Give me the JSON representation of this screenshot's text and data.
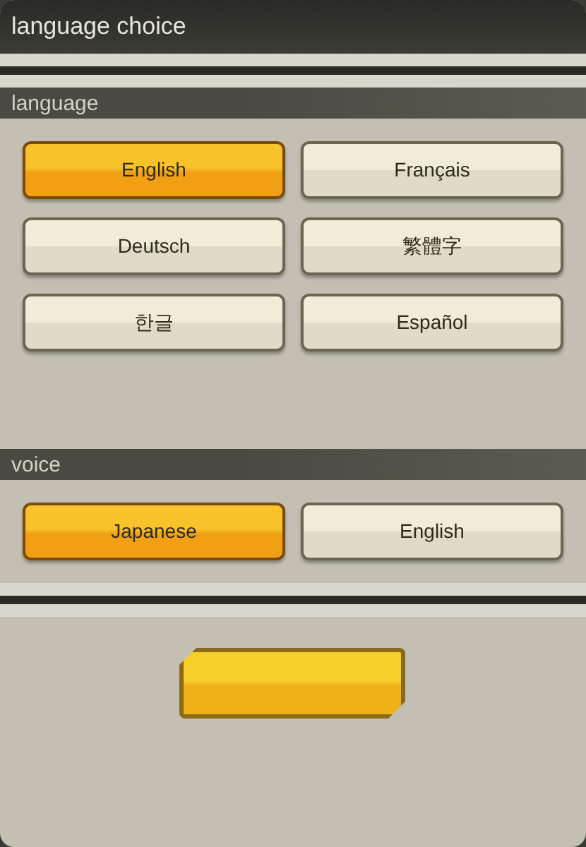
{
  "window": {
    "title": "language choice"
  },
  "sections": [
    {
      "title": "language",
      "options": [
        {
          "label": "English",
          "selected": true
        },
        {
          "label": "Français",
          "selected": false
        },
        {
          "label": "Deutsch",
          "selected": false
        },
        {
          "label": "繁體字",
          "selected": false
        },
        {
          "label": "한글",
          "selected": false
        },
        {
          "label": "Español",
          "selected": false
        }
      ]
    },
    {
      "title": "voice",
      "options": [
        {
          "label": "Japanese",
          "selected": true
        },
        {
          "label": "English",
          "selected": false
        }
      ]
    }
  ]
}
